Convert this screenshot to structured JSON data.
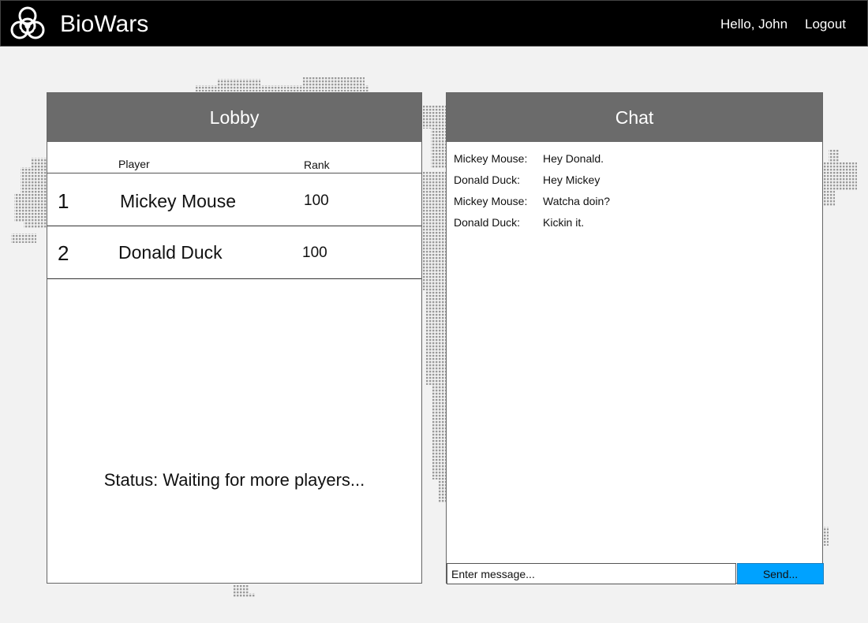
{
  "header": {
    "app_title": "BioWars",
    "logo_icon": "biohazard-icon",
    "greeting": "Hello, John",
    "logout_label": "Logout"
  },
  "lobby": {
    "title": "Lobby",
    "columns": {
      "player": "Player",
      "rank": "Rank"
    },
    "players": [
      {
        "position": "1",
        "name": "Mickey Mouse",
        "rank": "100"
      },
      {
        "position": "2",
        "name": "Donald Duck",
        "rank": "100"
      }
    ],
    "status": "Status: Waiting for more players..."
  },
  "chat": {
    "title": "Chat",
    "messages": [
      {
        "sender": "Mickey Mouse:",
        "text": "Hey Donald."
      },
      {
        "sender": "Donald Duck:",
        "text": "Hey Mickey"
      },
      {
        "sender": "Mickey Mouse:",
        "text": "Watcha doin?"
      },
      {
        "sender": "Donald Duck:",
        "text": "Kickin it."
      }
    ],
    "input_value": "",
    "input_placeholder": "Enter message...",
    "send_label": "Send..."
  },
  "colors": {
    "topbar": "#000000",
    "panel_header": "#6b6b6b",
    "send_button": "#00a2ff",
    "background": "#f2f2f2"
  }
}
